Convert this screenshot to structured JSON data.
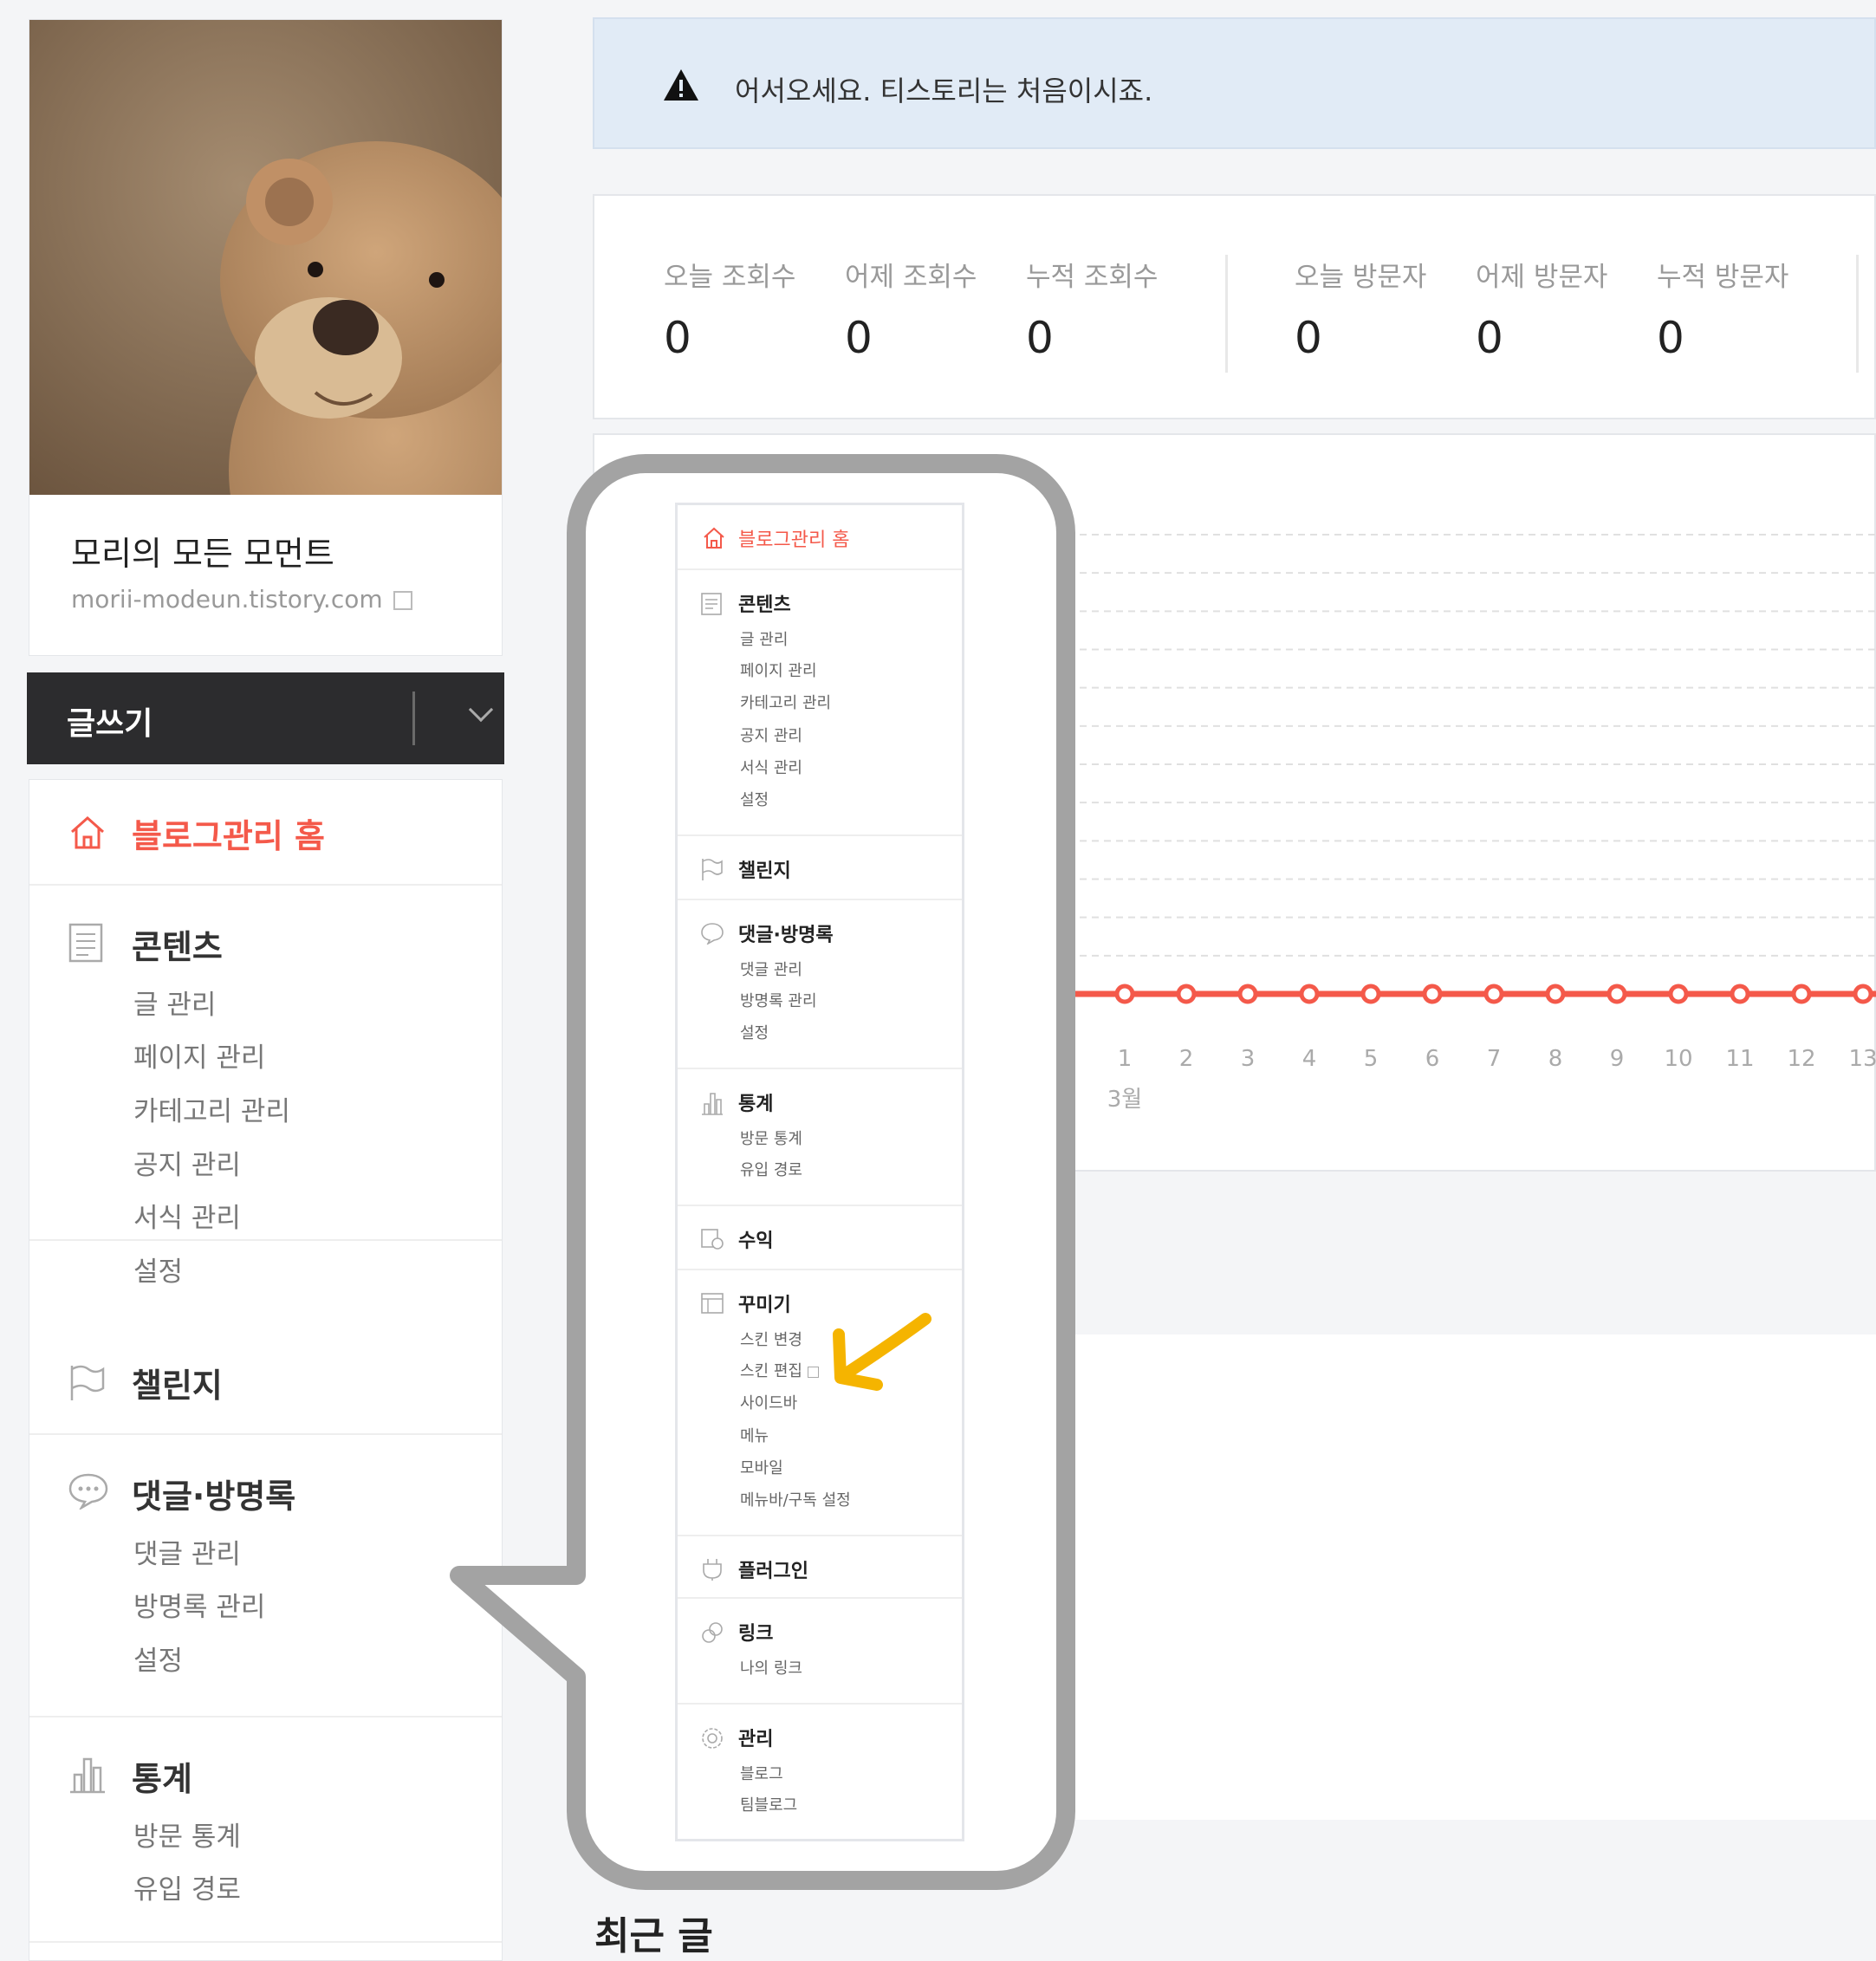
{
  "profile": {
    "blog_title": "모리의 모든 모먼트",
    "blog_url": "morii-modeun.tistory.com"
  },
  "write_button": {
    "label": "글쓰기"
  },
  "sidebar": {
    "home": "블로그관리 홈",
    "sections": [
      {
        "title": "콘텐츠",
        "icon": "document-icon",
        "items": [
          "글 관리",
          "페이지 관리",
          "카테고리 관리",
          "공지 관리",
          "서식 관리",
          "설정"
        ]
      },
      {
        "title": "챌린지",
        "icon": "flag-icon",
        "items": []
      },
      {
        "title": "댓글·방명록",
        "icon": "speech-bubble-icon",
        "items": [
          "댓글 관리",
          "방명록 관리",
          "설정"
        ]
      },
      {
        "title": "통계",
        "icon": "bar-chart-icon",
        "items": [
          "방문 통계",
          "유입 경로"
        ]
      }
    ]
  },
  "notice": {
    "text": "어서오세요. 티스토리는 처음이시죠."
  },
  "stats": [
    {
      "label": "오늘 조회수",
      "value": "0"
    },
    {
      "label": "어제 조회수",
      "value": "0"
    },
    {
      "label": "누적 조회수",
      "value": "0"
    },
    {
      "label": "오늘 방문자",
      "value": "0"
    },
    {
      "label": "어제 방문자",
      "value": "0"
    },
    {
      "label": "누적 방문자",
      "value": "0"
    }
  ],
  "chart_data": {
    "type": "line",
    "x": [
      "1",
      "2",
      "3",
      "4",
      "5",
      "6",
      "7",
      "8",
      "9",
      "10",
      "11",
      "12",
      "13"
    ],
    "x_group_label": "3월",
    "series": [
      {
        "values": [
          0,
          0,
          0,
          0,
          0,
          0,
          0,
          0,
          0,
          0,
          0,
          0,
          0
        ],
        "color": "#f4594a"
      }
    ],
    "grid": true
  },
  "popup_menu": {
    "home": "블로그관리 홈",
    "sections": [
      {
        "title": "콘텐츠",
        "icon": "document-icon",
        "items": [
          "글 관리",
          "페이지 관리",
          "카테고리 관리",
          "공지 관리",
          "서식 관리",
          "설정"
        ]
      },
      {
        "title": "챌린지",
        "icon": "flag-icon",
        "items": []
      },
      {
        "title": "댓글·방명록",
        "icon": "speech-bubble-icon",
        "items": [
          "댓글 관리",
          "방명록 관리",
          "설정"
        ]
      },
      {
        "title": "통계",
        "icon": "bar-chart-icon",
        "items": [
          "방문 통계",
          "유입 경로"
        ]
      },
      {
        "title": "수익",
        "icon": "revenue-icon",
        "items": []
      },
      {
        "title": "꾸미기",
        "icon": "layout-icon",
        "items": [
          "스킨 변경",
          "스킨 편집",
          "사이드바",
          "메뉴",
          "모바일",
          "메뉴바/구독 설정"
        ]
      },
      {
        "title": "플러그인",
        "icon": "plugin-icon",
        "items": []
      },
      {
        "title": "링크",
        "icon": "link-icon",
        "items": [
          "나의 링크"
        ]
      },
      {
        "title": "관리",
        "icon": "gear-icon",
        "items": [
          "블로그",
          "팀블로그"
        ]
      }
    ]
  },
  "recent_posts": {
    "title": "최근 글"
  },
  "colors": {
    "accent": "#f4594a",
    "highlight_arrow": "#f5b400",
    "callout_border": "#a3a3a3"
  }
}
